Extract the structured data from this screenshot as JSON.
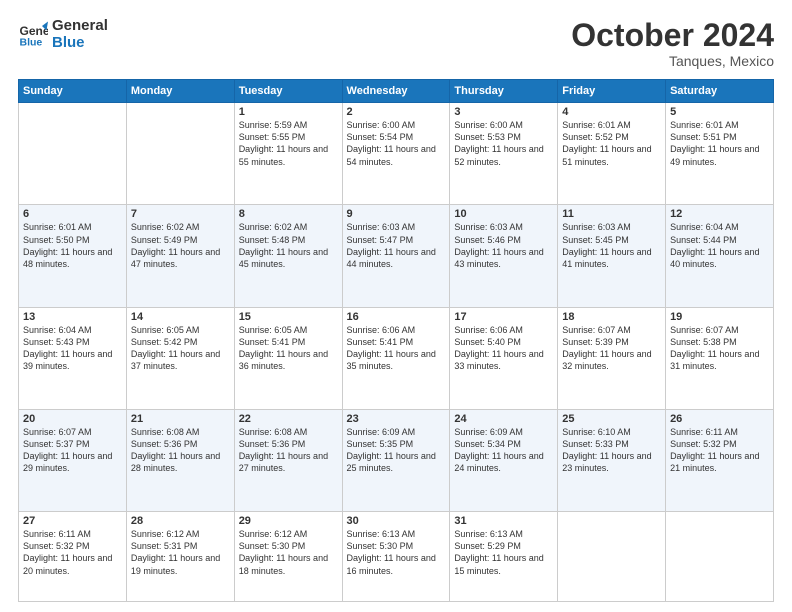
{
  "header": {
    "logo_line1": "General",
    "logo_line2": "Blue",
    "month": "October 2024",
    "location": "Tanques, Mexico"
  },
  "weekdays": [
    "Sunday",
    "Monday",
    "Tuesday",
    "Wednesday",
    "Thursday",
    "Friday",
    "Saturday"
  ],
  "weeks": [
    [
      {
        "day": "",
        "sunrise": "",
        "sunset": "",
        "daylight": ""
      },
      {
        "day": "",
        "sunrise": "",
        "sunset": "",
        "daylight": ""
      },
      {
        "day": "1",
        "sunrise": "Sunrise: 5:59 AM",
        "sunset": "Sunset: 5:55 PM",
        "daylight": "Daylight: 11 hours and 55 minutes."
      },
      {
        "day": "2",
        "sunrise": "Sunrise: 6:00 AM",
        "sunset": "Sunset: 5:54 PM",
        "daylight": "Daylight: 11 hours and 54 minutes."
      },
      {
        "day": "3",
        "sunrise": "Sunrise: 6:00 AM",
        "sunset": "Sunset: 5:53 PM",
        "daylight": "Daylight: 11 hours and 52 minutes."
      },
      {
        "day": "4",
        "sunrise": "Sunrise: 6:01 AM",
        "sunset": "Sunset: 5:52 PM",
        "daylight": "Daylight: 11 hours and 51 minutes."
      },
      {
        "day": "5",
        "sunrise": "Sunrise: 6:01 AM",
        "sunset": "Sunset: 5:51 PM",
        "daylight": "Daylight: 11 hours and 49 minutes."
      }
    ],
    [
      {
        "day": "6",
        "sunrise": "Sunrise: 6:01 AM",
        "sunset": "Sunset: 5:50 PM",
        "daylight": "Daylight: 11 hours and 48 minutes."
      },
      {
        "day": "7",
        "sunrise": "Sunrise: 6:02 AM",
        "sunset": "Sunset: 5:49 PM",
        "daylight": "Daylight: 11 hours and 47 minutes."
      },
      {
        "day": "8",
        "sunrise": "Sunrise: 6:02 AM",
        "sunset": "Sunset: 5:48 PM",
        "daylight": "Daylight: 11 hours and 45 minutes."
      },
      {
        "day": "9",
        "sunrise": "Sunrise: 6:03 AM",
        "sunset": "Sunset: 5:47 PM",
        "daylight": "Daylight: 11 hours and 44 minutes."
      },
      {
        "day": "10",
        "sunrise": "Sunrise: 6:03 AM",
        "sunset": "Sunset: 5:46 PM",
        "daylight": "Daylight: 11 hours and 43 minutes."
      },
      {
        "day": "11",
        "sunrise": "Sunrise: 6:03 AM",
        "sunset": "Sunset: 5:45 PM",
        "daylight": "Daylight: 11 hours and 41 minutes."
      },
      {
        "day": "12",
        "sunrise": "Sunrise: 6:04 AM",
        "sunset": "Sunset: 5:44 PM",
        "daylight": "Daylight: 11 hours and 40 minutes."
      }
    ],
    [
      {
        "day": "13",
        "sunrise": "Sunrise: 6:04 AM",
        "sunset": "Sunset: 5:43 PM",
        "daylight": "Daylight: 11 hours and 39 minutes."
      },
      {
        "day": "14",
        "sunrise": "Sunrise: 6:05 AM",
        "sunset": "Sunset: 5:42 PM",
        "daylight": "Daylight: 11 hours and 37 minutes."
      },
      {
        "day": "15",
        "sunrise": "Sunrise: 6:05 AM",
        "sunset": "Sunset: 5:41 PM",
        "daylight": "Daylight: 11 hours and 36 minutes."
      },
      {
        "day": "16",
        "sunrise": "Sunrise: 6:06 AM",
        "sunset": "Sunset: 5:41 PM",
        "daylight": "Daylight: 11 hours and 35 minutes."
      },
      {
        "day": "17",
        "sunrise": "Sunrise: 6:06 AM",
        "sunset": "Sunset: 5:40 PM",
        "daylight": "Daylight: 11 hours and 33 minutes."
      },
      {
        "day": "18",
        "sunrise": "Sunrise: 6:07 AM",
        "sunset": "Sunset: 5:39 PM",
        "daylight": "Daylight: 11 hours and 32 minutes."
      },
      {
        "day": "19",
        "sunrise": "Sunrise: 6:07 AM",
        "sunset": "Sunset: 5:38 PM",
        "daylight": "Daylight: 11 hours and 31 minutes."
      }
    ],
    [
      {
        "day": "20",
        "sunrise": "Sunrise: 6:07 AM",
        "sunset": "Sunset: 5:37 PM",
        "daylight": "Daylight: 11 hours and 29 minutes."
      },
      {
        "day": "21",
        "sunrise": "Sunrise: 6:08 AM",
        "sunset": "Sunset: 5:36 PM",
        "daylight": "Daylight: 11 hours and 28 minutes."
      },
      {
        "day": "22",
        "sunrise": "Sunrise: 6:08 AM",
        "sunset": "Sunset: 5:36 PM",
        "daylight": "Daylight: 11 hours and 27 minutes."
      },
      {
        "day": "23",
        "sunrise": "Sunrise: 6:09 AM",
        "sunset": "Sunset: 5:35 PM",
        "daylight": "Daylight: 11 hours and 25 minutes."
      },
      {
        "day": "24",
        "sunrise": "Sunrise: 6:09 AM",
        "sunset": "Sunset: 5:34 PM",
        "daylight": "Daylight: 11 hours and 24 minutes."
      },
      {
        "day": "25",
        "sunrise": "Sunrise: 6:10 AM",
        "sunset": "Sunset: 5:33 PM",
        "daylight": "Daylight: 11 hours and 23 minutes."
      },
      {
        "day": "26",
        "sunrise": "Sunrise: 6:11 AM",
        "sunset": "Sunset: 5:32 PM",
        "daylight": "Daylight: 11 hours and 21 minutes."
      }
    ],
    [
      {
        "day": "27",
        "sunrise": "Sunrise: 6:11 AM",
        "sunset": "Sunset: 5:32 PM",
        "daylight": "Daylight: 11 hours and 20 minutes."
      },
      {
        "day": "28",
        "sunrise": "Sunrise: 6:12 AM",
        "sunset": "Sunset: 5:31 PM",
        "daylight": "Daylight: 11 hours and 19 minutes."
      },
      {
        "day": "29",
        "sunrise": "Sunrise: 6:12 AM",
        "sunset": "Sunset: 5:30 PM",
        "daylight": "Daylight: 11 hours and 18 minutes."
      },
      {
        "day": "30",
        "sunrise": "Sunrise: 6:13 AM",
        "sunset": "Sunset: 5:30 PM",
        "daylight": "Daylight: 11 hours and 16 minutes."
      },
      {
        "day": "31",
        "sunrise": "Sunrise: 6:13 AM",
        "sunset": "Sunset: 5:29 PM",
        "daylight": "Daylight: 11 hours and 15 minutes."
      },
      {
        "day": "",
        "sunrise": "",
        "sunset": "",
        "daylight": ""
      },
      {
        "day": "",
        "sunrise": "",
        "sunset": "",
        "daylight": ""
      }
    ]
  ]
}
